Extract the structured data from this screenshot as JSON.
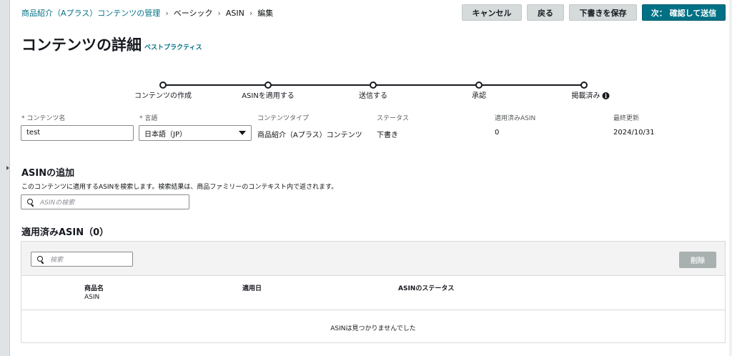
{
  "breadcrumb": {
    "items": [
      "商品紹介（Aプラス）コンテンツの管理",
      "ベーシック",
      "ASIN",
      "編集"
    ],
    "separator": "›"
  },
  "actions": {
    "cancel": "キャンセル",
    "back": "戻る",
    "save_draft": "下書きを保存",
    "next": "次： 確認して送信"
  },
  "page": {
    "title": "コンテンツの詳細",
    "best_practices": "ベストプラクティス"
  },
  "stepper": {
    "steps": [
      "コンテンツの作成",
      "ASINを適用する",
      "送信する",
      "承認",
      "掲載済み"
    ],
    "info_glyph": "i"
  },
  "details": {
    "required_mark": "*",
    "content_name_label": "コンテンツ名",
    "content_name_value": "test",
    "language_label": "言語",
    "language_value": "日本語（JP）",
    "content_type_label": "コンテンツタイプ",
    "content_type_value": "商品紹介（Aプラス）コンテンツ",
    "status_label": "ステータス",
    "status_value": "下書き",
    "applied_asin_label": "適用済みASIN",
    "applied_asin_value": "0",
    "last_updated_label": "最終更新",
    "last_updated_value": "2024/10/31"
  },
  "add_asin": {
    "title": "ASINの追加",
    "description": "このコンテンツに適用するASINを検索します。検索結果は、商品ファミリーのコンテキスト内で返されます。",
    "search_placeholder": "ASINの検索"
  },
  "applied": {
    "title": "適用済みASIN（0）",
    "search_placeholder": "検索",
    "delete": "削除",
    "columns": {
      "product_name": "商品名",
      "product_sub": "ASIN",
      "applied_date": "適用日",
      "asin_status": "ASINのステータス"
    },
    "empty_message": "ASINは見つかりませんでした"
  },
  "colors": {
    "link": "#007185",
    "primary_button": "#007185",
    "secondary_button": "#d5dbdb",
    "disabled_button": "#a8b0b0"
  }
}
